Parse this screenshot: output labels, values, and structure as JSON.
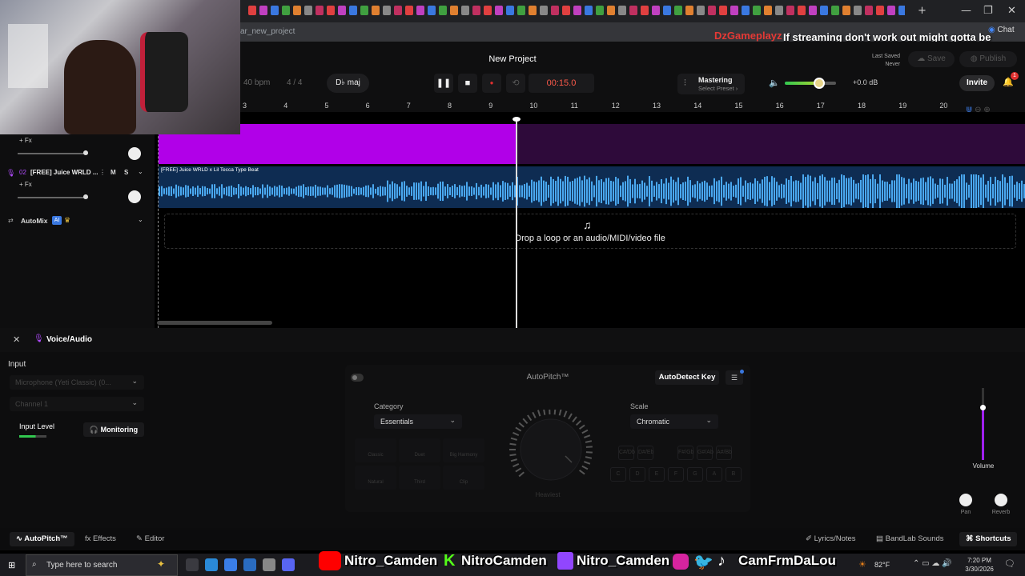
{
  "browser": {
    "url": "ar_new_project",
    "chat": {
      "username": "DzGameplayz",
      "message": "If streaming don't work out might gotta be a SoundCloud rapper",
      "button": "Chat"
    },
    "window_controls": [
      "—",
      "❐",
      "✕"
    ]
  },
  "header": {
    "project_title": "New Project",
    "bpm": "40 bpm",
    "time_signature": "4 / 4",
    "key": "D♭ maj",
    "time": "00:15.0",
    "mastering": {
      "title": "Mastering",
      "subtitle": "Select Preset ›"
    },
    "volume_db": "+0.0 dB",
    "volume_level": 0.7,
    "last_saved_label": "Last Saved",
    "last_saved_value": "Never",
    "save": "Save",
    "publish": "Publish",
    "invite": "Invite",
    "notification_count": "1"
  },
  "ruler": {
    "marks": [
      "3",
      "4",
      "5",
      "6",
      "7",
      "8",
      "9",
      "10",
      "11",
      "12",
      "13",
      "14",
      "15",
      "16",
      "17",
      "18",
      "19",
      "20"
    ]
  },
  "tracks": {
    "track1": {
      "fx": "+ Fx"
    },
    "track2": {
      "number": "02",
      "name": "[FREE] Juice WRLD ...",
      "mute": "M",
      "solo": "S",
      "fx": "+ Fx",
      "clip_label": "[FREE] Juice WRLD x Lil Tecca Type Beat"
    },
    "automix": {
      "label": "AutoMix",
      "badge": "AI"
    },
    "drop_text": "Drop a loop or an audio/MIDI/video file"
  },
  "panel": {
    "title": "Voice/Audio",
    "input_label": "Input",
    "mic": "Microphone (Yeti Classic) (0...",
    "channel": "Channel 1",
    "input_level_label": "Input Level",
    "monitoring": "Monitoring",
    "autopitch": {
      "title": "AutoPitch™",
      "autodetect": "AutoDetect Key",
      "category_label": "Category",
      "category_value": "Essentials",
      "scale_label": "Scale",
      "scale_value": "Chromatic",
      "presets": [
        "Classic",
        "Duet",
        "Big Harmony",
        "Natural",
        "Third",
        "Clip"
      ],
      "dial_label": "Heaviest",
      "accidentals": [
        "C#/Db",
        "D#/Eb",
        "F#/Gb",
        "G#/Ab",
        "A#/Bb"
      ],
      "notes": [
        "C",
        "D",
        "E",
        "F",
        "G",
        "A",
        "B"
      ]
    },
    "volume_label": "Volume",
    "pan_label": "Pan",
    "reverb_label": "Reverb"
  },
  "bottom_tabs": {
    "autopitch": "AutoPitch™",
    "effects": "Effects",
    "editor": "Editor",
    "lyrics": "Lyrics/Notes",
    "sounds": "BandLab Sounds",
    "shortcuts": "Shortcuts"
  },
  "taskbar": {
    "search_placeholder": "Type here to search",
    "social": [
      "Nitro_Camden",
      "NitroCamden",
      "Nitro_Camden",
      "CamFrmDaLou"
    ],
    "temperature": "82°F",
    "time": "7:20 PM",
    "date": "3/30/2026"
  },
  "colors": {
    "track_purple": "#b100e8",
    "waveform_blue": "#4aa8f0",
    "accent_blue": "#3a78e0",
    "record_red": "#ff5a4a"
  }
}
